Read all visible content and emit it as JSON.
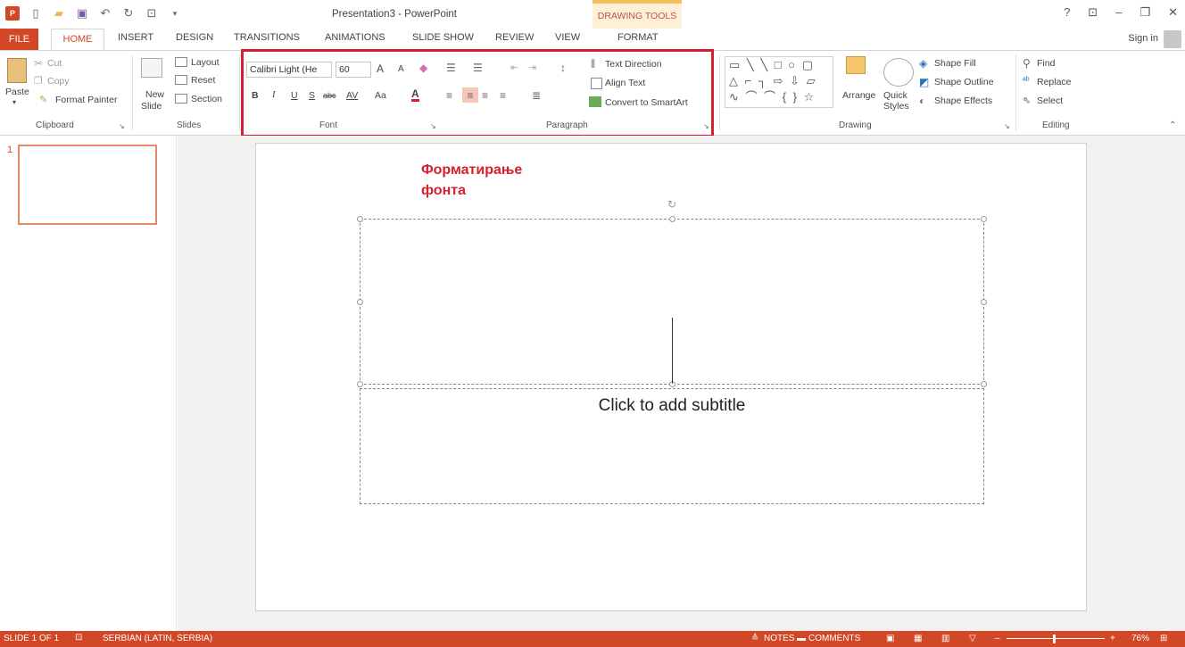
{
  "titlebar": {
    "app_icon": "P",
    "window_title": "Presentation3 - PowerPoint",
    "context_group": "DRAWING TOOLS",
    "help": "?",
    "restore_ribbon": "⊡",
    "minimize": "–",
    "maximize": "❐",
    "close": "✕"
  },
  "tabs": {
    "file": "FILE",
    "home": "HOME",
    "insert": "INSERT",
    "design": "DESIGN",
    "transitions": "TRANSITIONS",
    "animations": "ANIMATIONS",
    "slideshow": "SLIDE SHOW",
    "review": "REVIEW",
    "view": "VIEW",
    "format": "FORMAT",
    "signin": "Sign in"
  },
  "ribbon": {
    "clipboard": {
      "paste": "Paste",
      "cut": "Cut",
      "copy": "Copy",
      "format_painter": "Format Painter",
      "label": "Clipboard"
    },
    "slides": {
      "new_slide": "New",
      "new_slide2": "Slide",
      "layout": "Layout",
      "reset": "Reset",
      "section": "Section",
      "label": "Slides"
    },
    "font": {
      "family": "Calibri Light (He",
      "size": "60",
      "grow": "A",
      "shrink": "A",
      "bold": "B",
      "italic": "I",
      "underline": "U",
      "shadow": "S",
      "strike": "abc",
      "spacing": "AV",
      "case": "Aa",
      "color": "A",
      "label": "Font"
    },
    "paragraph": {
      "text_direction": "Text Direction",
      "align_text": "Align Text",
      "convert_smartart": "Convert to SmartArt",
      "label": "Paragraph"
    },
    "drawing": {
      "arrange": "Arrange",
      "quick": "Quick",
      "styles": "Styles",
      "shape_fill": "Shape Fill",
      "shape_outline": "Shape Outline",
      "shape_effects": "Shape Effects",
      "label": "Drawing"
    },
    "editing": {
      "find": "Find",
      "replace": "Replace",
      "select": "Select",
      "label": "Editing"
    }
  },
  "thumbnails": {
    "slide_number": "1"
  },
  "slide": {
    "title_line1": "Форматирање",
    "title_line2": "фонта",
    "subtitle_placeholder": "Click to add subtitle"
  },
  "statusbar": {
    "slide_of": "SLIDE 1 OF 1",
    "language": "SERBIAN (LATIN, SERBIA)",
    "notes": "NOTES",
    "comments": "COMMENTS",
    "zoom": "76%"
  },
  "colors": {
    "accent": "#d24726",
    "highlight_box": "#d42030",
    "slide_title": "#d42030"
  }
}
